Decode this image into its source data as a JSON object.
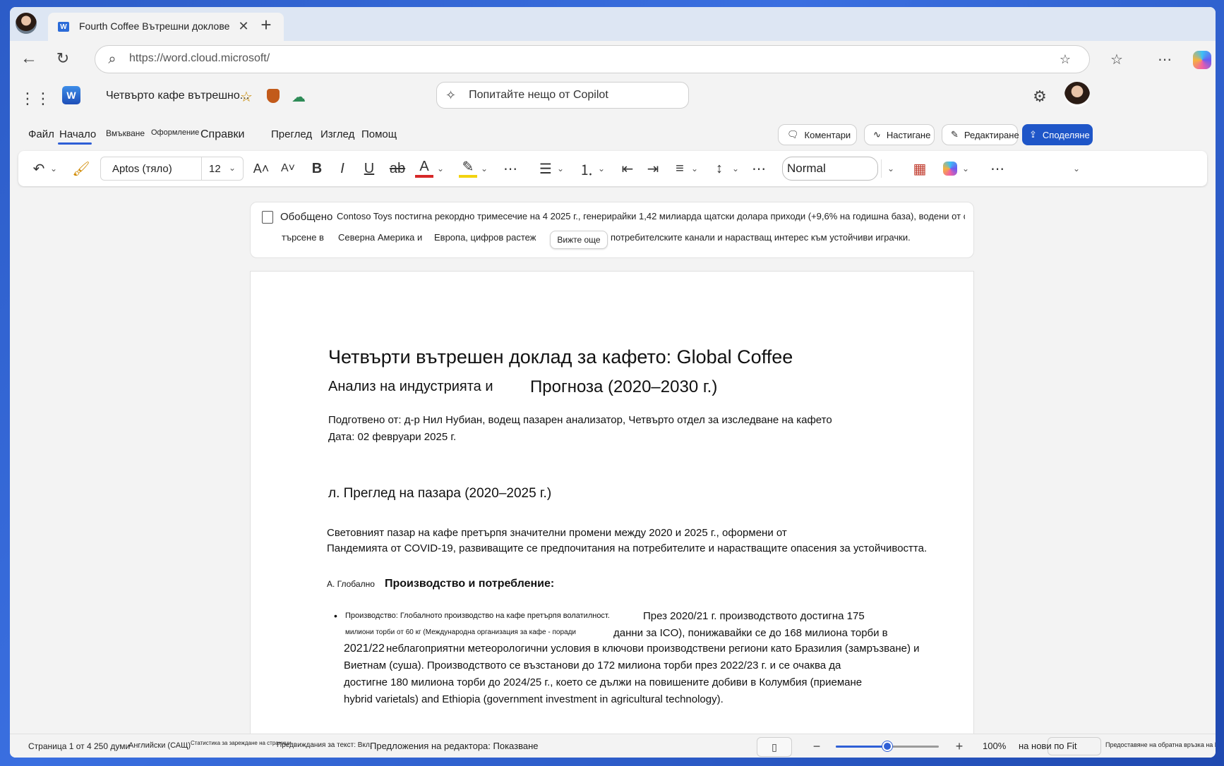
{
  "browser": {
    "tab_title": "Fourth Coffee Вътрешни доклове",
    "url": "https://word.cloud.microsoft/"
  },
  "app": {
    "doc_title": "Четвърто кафе вътрешно...",
    "copilot_placeholder": "Попитайте нещо от Copilot"
  },
  "menu": {
    "items": [
      "Файл",
      "Начало",
      "Вмъкване",
      "Оформление",
      "Справки",
      "Преглед",
      "Изглед",
      "Помощ"
    ],
    "active": "Начало",
    "comments": "Коментари",
    "catchup": "Настигане",
    "editing": "Редактиране",
    "share": "Споделяне"
  },
  "ribbon": {
    "font_name": "Aptos (тяло)",
    "font_size": "12",
    "style": "Normal"
  },
  "summary": {
    "label": "Обобщено",
    "line1": "Contoso Toys постигна рекордно тримесечие на 4 2025 г., генерирайки 1,42 милиарда щатски долара приходи (+9,6% на годишна база), водени от силните празници",
    "line2_a": "търсене в",
    "line2_b": "Северна Америка и",
    "line2_c": "Европа, цифров растеж",
    "line2_d": "потребителските канали и нарастващ интерес към устойчиви играчки.",
    "see_more": "Вижте още"
  },
  "document": {
    "title1": "Четвърти вътрешен доклад за кафето: Global Coffee",
    "title2a": "Анализ на индустрията и",
    "title2b": "Прогноза (2020–2030 г.)",
    "prepared": "Подготвено от: д-р Нил Нубиан, водещ пазарен анализатор, Четвърто отдел за изследване на кафето",
    "date": "Дата: 02 февруари 2025 г.",
    "section1": "л. Преглед на пазара (2020–2025 г.)",
    "para1_l1": "Световният пазар на кафе претърпя значителни промени между 2020 и 2025 г., оформени от",
    "para1_l2": "Пандемията от COVID-19, развиващите се предпочитания на потребителите и нарастващите опасения за устойчивостта.",
    "sub_a_small": "A. Глобално",
    "sub_a_big": "Производство и потребление:",
    "bullet_small1": "Производство: Глобалното производство на кафе претърпя волатилност.",
    "bullet_big1": "През 2020/21 г. производството достигна 175",
    "bullet_small2": "милиони торби от 60 кг (Международна организация за кафе - поради",
    "bullet_big2": "данни за ICO), понижавайки се до 168 милиона торби в",
    "bullet_l3a": "2021/22",
    "bullet_l3b": "неблагоприятни метеорологични условия в ключови производствени региони като Бразилия (замръзване) и",
    "bullet_l4": "Виетнам (суша). Производството се възстанови до 172 милиона торби през 2022/23 г. и се очаква да",
    "bullet_l5": "достигне 180 милиона торби до 2024/25 г., което се дължи на повишените добиви в Колумбия (приемане",
    "bullet_l6": "hybrid varietals) and Ethiopia (government investment in agricultural technology)."
  },
  "status": {
    "page": "Страница 1 от 4 250 думи",
    "language": "Английски (САЩ)",
    "stats": "Статистика за зареждане на страници",
    "predictions": "Предвиждания за текст: Вкл.",
    "editor": "Предложения на редактора: Показване",
    "zoom": "100%",
    "zoom_fraction": 0.5,
    "fit": "на нови по Fit",
    "feedback": "Предоставяне на обратна връзка на Microsoft"
  },
  "colors": {
    "accent": "#2f5fd6",
    "share_bg": "#1f56c8"
  }
}
